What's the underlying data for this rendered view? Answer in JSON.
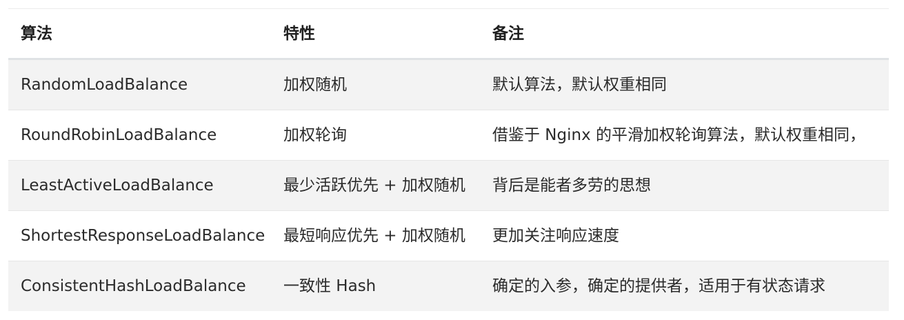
{
  "table": {
    "headers": [
      "算法",
      "特性",
      "备注"
    ],
    "rows": [
      [
        "RandomLoadBalance",
        "加权随机",
        "默认算法，默认权重相同"
      ],
      [
        "RoundRobinLoadBalance",
        "加权轮询",
        "借鉴于 Nginx 的平滑加权轮询算法，默认权重相同，"
      ],
      [
        "LeastActiveLoadBalance",
        "最少活跃优先 + 加权随机",
        "背后是能者多劳的思想"
      ],
      [
        "ShortestResponseLoadBalance",
        "最短响应优先 + 加权随机",
        "更加关注响应速度"
      ],
      [
        "ConsistentHashLoadBalance",
        "一致性 Hash",
        "确定的入参，确定的提供者，适用于有状态请求"
      ]
    ]
  }
}
